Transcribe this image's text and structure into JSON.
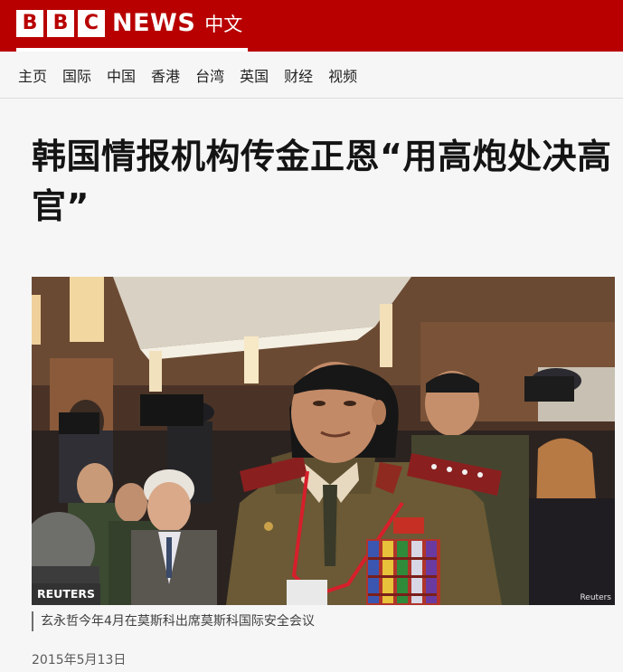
{
  "header": {
    "logo_letters": [
      "B",
      "B",
      "C"
    ],
    "logo_news": "NEWS",
    "logo_zh": "中文",
    "brand_color": "#b80000"
  },
  "nav": {
    "items": [
      "主页",
      "国际",
      "中国",
      "香港",
      "台湾",
      "英国",
      "财经",
      "视频"
    ]
  },
  "article": {
    "headline": "韩国情报机构传金正恩“用高炮处决高官”",
    "image_badge": "REUTERS",
    "image_credit": "Reuters",
    "image_caption": "玄永哲今年4月在莫斯科出席莫斯科国际安全会议",
    "date": "2015年5月13日"
  }
}
